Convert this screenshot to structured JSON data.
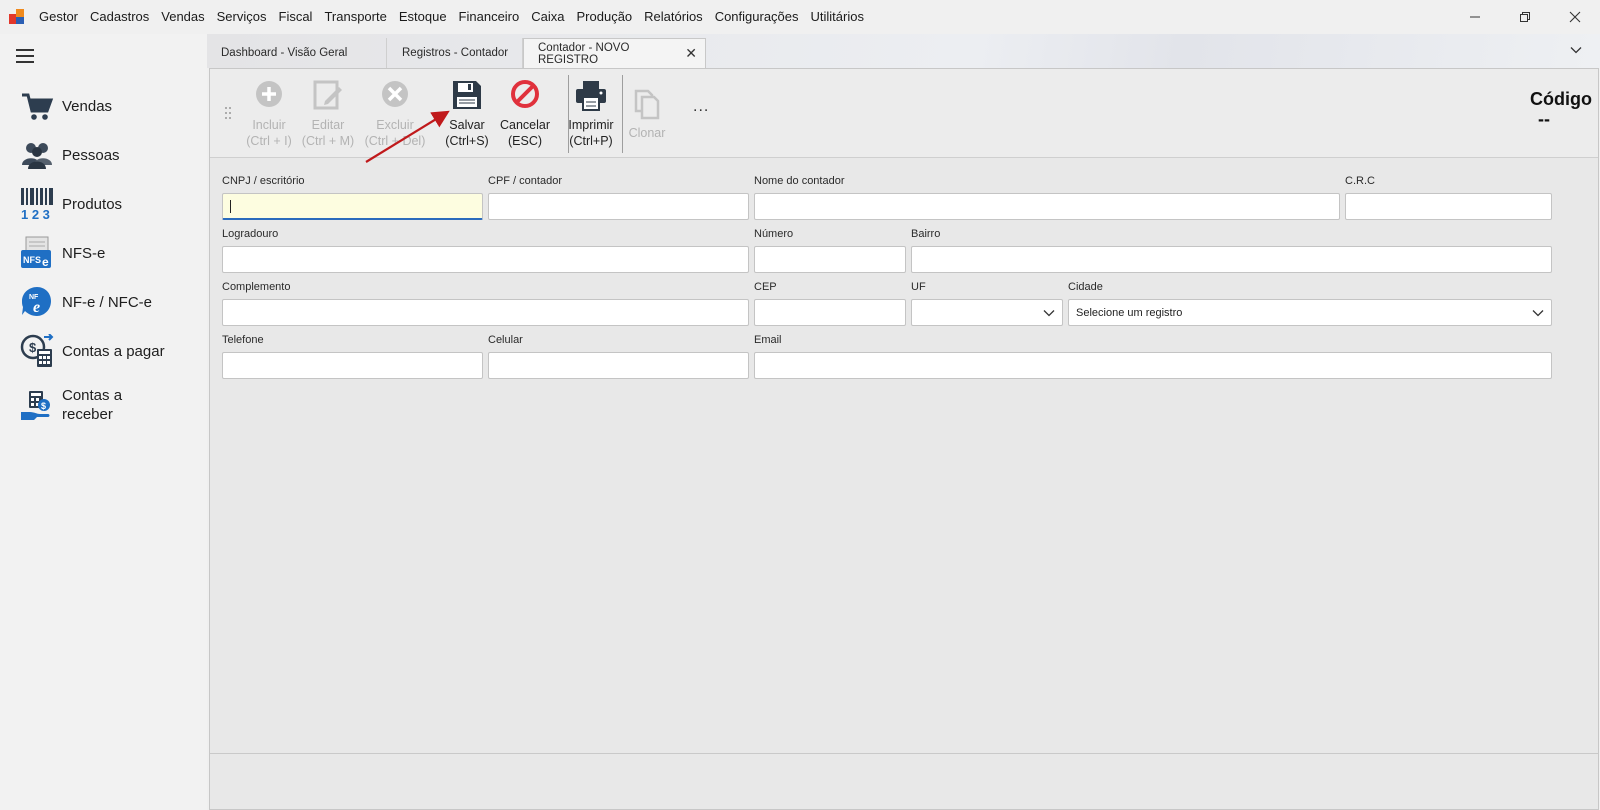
{
  "menu": {
    "items": [
      "Gestor",
      "Cadastros",
      "Vendas",
      "Serviços",
      "Fiscal",
      "Transporte",
      "Estoque",
      "Financeiro",
      "Caixa",
      "Produção",
      "Relatórios",
      "Configurações",
      "Utilitários"
    ]
  },
  "sidebar": {
    "items": [
      {
        "label": "Vendas",
        "icon": "cart-icon"
      },
      {
        "label": "Pessoas",
        "icon": "people-icon"
      },
      {
        "label": "Produtos",
        "icon": "barcode-icon"
      },
      {
        "label": "NFS-e",
        "icon": "nfse-icon"
      },
      {
        "label": "NF-e / NFC-e",
        "icon": "nfe-icon"
      },
      {
        "label": "Contas a pagar",
        "icon": "calculator-money-icon"
      },
      {
        "label": "Contas a receber",
        "icon": "hand-money-icon"
      }
    ]
  },
  "tabs": [
    {
      "label": "Dashboard - Visão Geral",
      "active": false
    },
    {
      "label": "Registros - Contador",
      "active": false
    },
    {
      "label": "Contador - NOVO REGISTRO",
      "active": true
    }
  ],
  "toolbar": {
    "incluir": {
      "label": "Incluir",
      "shortcut": "(Ctrl + I)",
      "enabled": false
    },
    "editar": {
      "label": "Editar",
      "shortcut": "(Ctrl + M)",
      "enabled": false
    },
    "excluir": {
      "label": "Excluir",
      "shortcut": "(Ctrl + Del)",
      "enabled": false
    },
    "salvar": {
      "label": "Salvar",
      "shortcut": "(Ctrl+S)",
      "enabled": true
    },
    "cancelar": {
      "label": "Cancelar",
      "shortcut": "(ESC)",
      "enabled": true
    },
    "imprimir": {
      "label": "Imprimir",
      "shortcut": "(Ctrl+P)",
      "enabled": true
    },
    "clonar": {
      "label": "Clonar",
      "enabled": false
    },
    "more": "..."
  },
  "record": {
    "codigo_label": "Código",
    "codigo_value": "--"
  },
  "form": {
    "cnpj": {
      "label": "CNPJ / escritório",
      "value": ""
    },
    "cpf": {
      "label": "CPF / contador",
      "value": ""
    },
    "nome": {
      "label": "Nome do contador",
      "value": ""
    },
    "crc": {
      "label": "C.R.C",
      "value": ""
    },
    "logradouro": {
      "label": "Logradouro",
      "value": ""
    },
    "numero": {
      "label": "Número",
      "value": ""
    },
    "bairro": {
      "label": "Bairro",
      "value": ""
    },
    "complemento": {
      "label": "Complemento",
      "value": ""
    },
    "cep": {
      "label": "CEP",
      "value": ""
    },
    "uf": {
      "label": "UF",
      "value": ""
    },
    "cidade": {
      "label": "Cidade",
      "value": "Selecione um registro"
    },
    "telefone": {
      "label": "Telefone",
      "value": ""
    },
    "celular": {
      "label": "Celular",
      "value": ""
    },
    "email": {
      "label": "Email",
      "value": ""
    }
  },
  "colors": {
    "annotation_arrow": "#c0191b",
    "cancel_red": "#e0313c",
    "focus_bg": "#fdfde0",
    "focus_border": "#2a6bbd"
  }
}
